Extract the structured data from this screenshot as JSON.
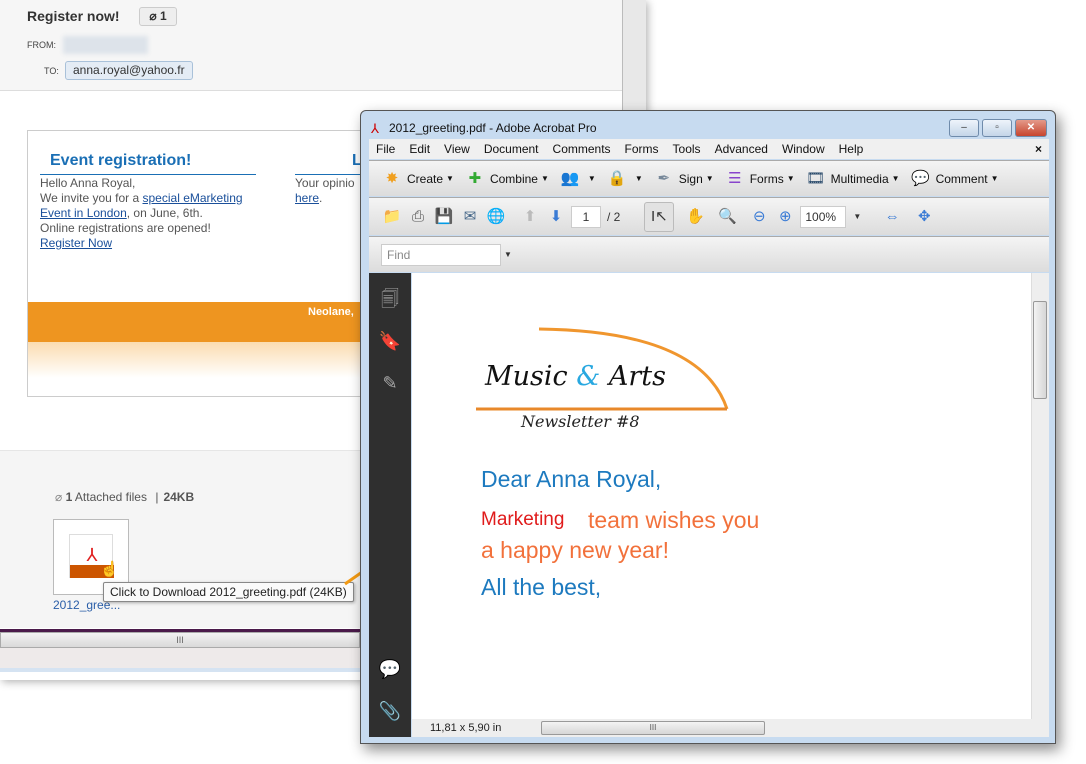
{
  "email": {
    "subject": "Register now!",
    "attach_count": "1",
    "from_label": "FROM:",
    "to_label": "TO:",
    "to_value": "anna.royal@yahoo.fr",
    "newsletter": {
      "heading": "Event registration!",
      "hello": "Hello Anna Royal,",
      "invite_pre": "We invite you for a ",
      "invite_link": "special eMarketing Event in London",
      "invite_post": ", on June, 6th.",
      "online": "Online registrations are opened!",
      "register_link": "Register Now",
      "right_heading": "L",
      "right_text": "Your opinio",
      "right_link": "here",
      "right_post": ".",
      "footer": "Neolane,"
    },
    "attachments": {
      "count": "1",
      "label": "Attached files",
      "sep": "|",
      "size": "24KB",
      "file_name": "2012_gree...",
      "tooltip": "Click to Download 2012_greeting.pdf (24KB)"
    },
    "scroll_grip": "III"
  },
  "acrobat": {
    "title": "2012_greeting.pdf - Adobe Acrobat Pro",
    "window_buttons": [
      "–",
      "▫",
      "✕"
    ],
    "menu": [
      "File",
      "Edit",
      "View",
      "Document",
      "Comments",
      "Forms",
      "Tools",
      "Advanced",
      "Window",
      "Help"
    ],
    "menu_close": "×",
    "tasks": [
      {
        "label": "Create",
        "icon": "create-icon"
      },
      {
        "label": "Combine",
        "icon": "combine-icon"
      },
      {
        "label": "",
        "icon": "collaborate-icon"
      },
      {
        "label": "",
        "icon": "lock-icon"
      },
      {
        "label": "Sign",
        "icon": "pen-icon"
      },
      {
        "label": "Forms",
        "icon": "forms-icon"
      },
      {
        "label": "Multimedia",
        "icon": "multimedia-icon"
      },
      {
        "label": "Comment",
        "icon": "comment-icon"
      }
    ],
    "page_current": "1",
    "page_total": "/ 2",
    "zoom": "100%",
    "find_placeholder": "Find",
    "dimensions": "11,81 x 5,90 in",
    "document": {
      "logo_part1": "Music ",
      "logo_amp": "&",
      "logo_part2": " Arts",
      "logo_sub": "Newsletter #8",
      "dear": "Dear  Anna Royal,",
      "marketing": "Marketing",
      "team": "team wishes you",
      "happy": "a happy new year!",
      "best": "All the best,"
    }
  }
}
